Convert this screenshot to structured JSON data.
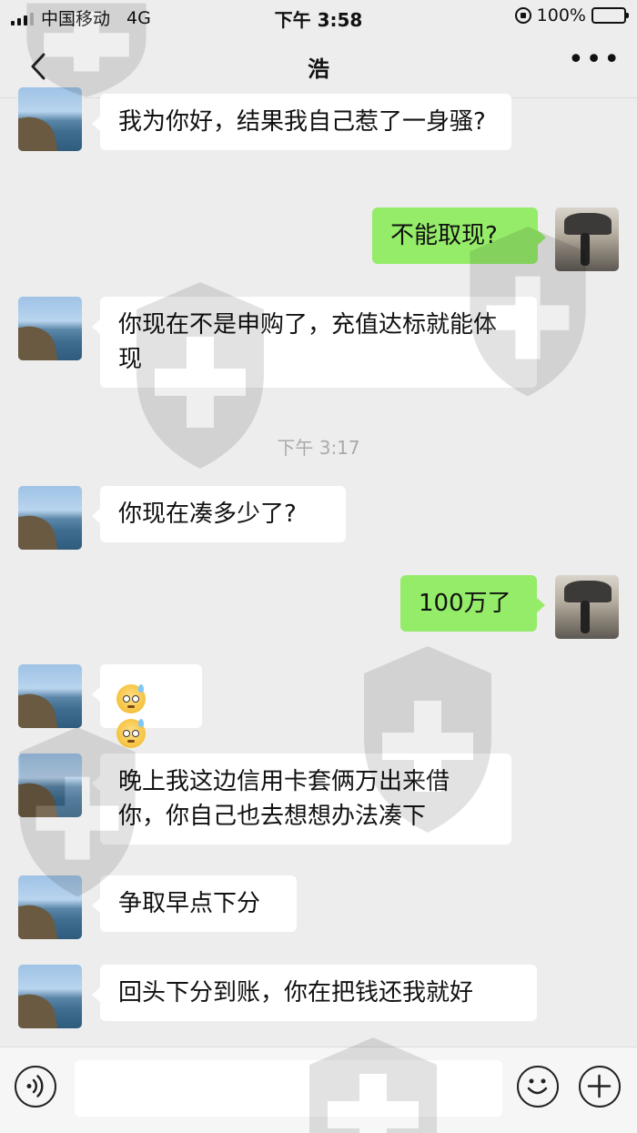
{
  "status_bar": {
    "carrier": "中国移动",
    "network": "4G",
    "time": "下午 3:58",
    "battery_percent": "100%"
  },
  "nav": {
    "title": "浩",
    "back_icon": "chevron-left-icon",
    "more_label": "•••"
  },
  "messages": [
    {
      "side": "left",
      "text": "我为你好，结果我自己惹了一身骚?"
    },
    {
      "side": "right",
      "text": "不能取现?"
    },
    {
      "side": "left",
      "text": "你现在不是申购了，充值达标就能体现"
    },
    {
      "side": "left",
      "text": "你现在凑多少了?"
    },
    {
      "side": "right",
      "text": "100万了"
    },
    {
      "side": "left",
      "text": "晚上我这边信用卡套俩万出来借你，你自己也去想想办法凑下"
    },
    {
      "side": "left",
      "text": "争取早点下分"
    },
    {
      "side": "left",
      "text": "回头下分到账，你在把钱还我就好"
    }
  ],
  "timestamp": "下午 3:17",
  "colors": {
    "background": "#ededed",
    "bubble_left": "#ffffff",
    "bubble_right": "#95ec69",
    "timestamp": "#aaaaaa"
  },
  "input_bar": {
    "voice_icon": "voice-icon",
    "emoji_icon": "emoji-icon",
    "plus_icon": "plus-icon",
    "value": ""
  }
}
